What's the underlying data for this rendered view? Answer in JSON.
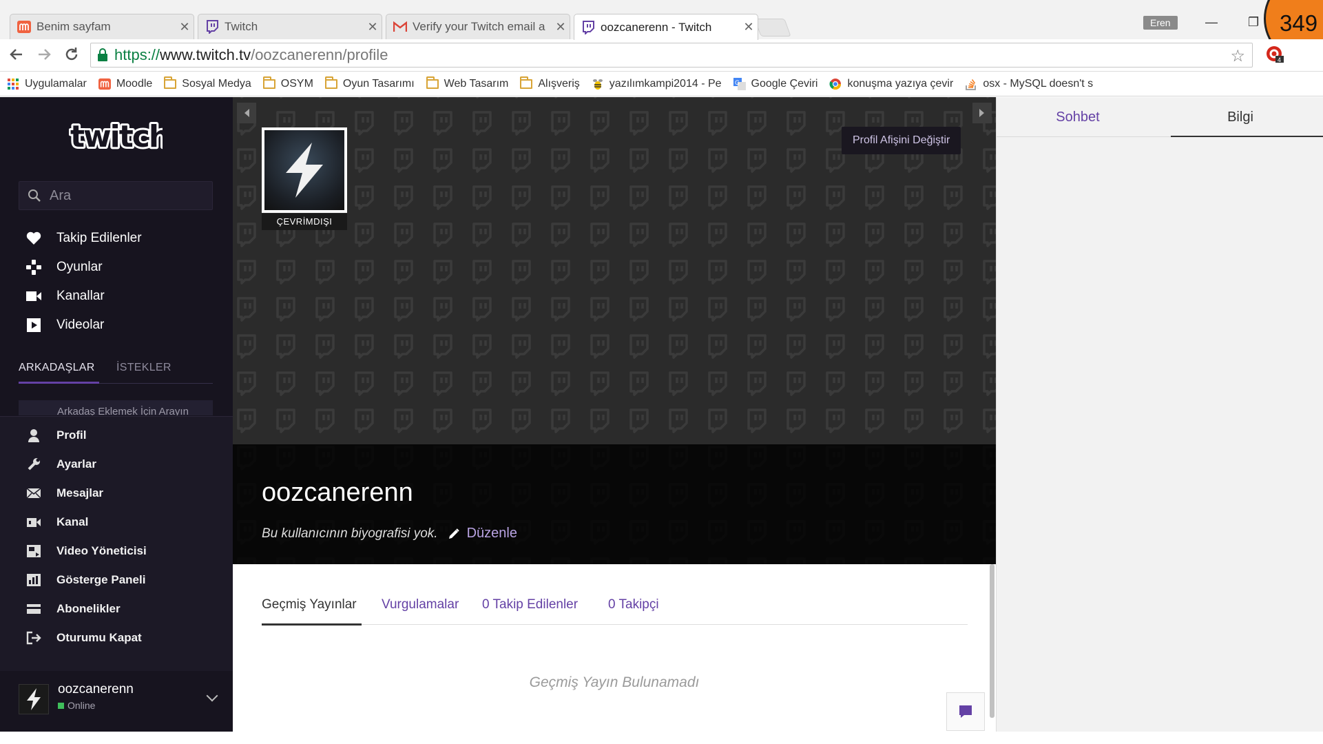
{
  "browser": {
    "tabs": [
      {
        "title": "Benim sayfam",
        "icon": "moodle-icon"
      },
      {
        "title": "Twitch",
        "icon": "twitch-icon"
      },
      {
        "title": "Verify your Twitch email a",
        "icon": "gmail-icon"
      },
      {
        "title": "oozcanerenn - Twitch",
        "icon": "twitch-icon",
        "active": true
      }
    ],
    "user_badge": "Eren",
    "counter_badge": "349",
    "url": {
      "scheme": "https://",
      "host": "www.twitch.tv",
      "path": "/oozcanerenn/profile"
    },
    "bookmarks": [
      {
        "label": "Uygulamalar",
        "icon": "apps-grid-icon"
      },
      {
        "label": "Moodle",
        "icon": "moodle-icon"
      },
      {
        "label": "Sosyal Medya",
        "icon": "folder-icon"
      },
      {
        "label": "OSYM",
        "icon": "folder-icon"
      },
      {
        "label": "Oyun Tasarımı",
        "icon": "folder-icon"
      },
      {
        "label": "Web Tasarım",
        "icon": "folder-icon"
      },
      {
        "label": "Alışveriş",
        "icon": "folder-icon"
      },
      {
        "label": "yazılımkampi2014 - Pe",
        "icon": "bee-icon"
      },
      {
        "label": "Google Çeviri",
        "icon": "translate-icon"
      },
      {
        "label": "konuşma yazıya çevir",
        "icon": "chrome-icon"
      },
      {
        "label": "osx - MySQL doesn't s",
        "icon": "stackoverflow-icon"
      }
    ]
  },
  "sidebar": {
    "search_placeholder": "Ara",
    "nav": [
      {
        "label": "Takip Edilenler",
        "icon": "heart-icon"
      },
      {
        "label": "Oyunlar",
        "icon": "gamepad-icon"
      },
      {
        "label": "Kanallar",
        "icon": "camera-icon"
      },
      {
        "label": "Videolar",
        "icon": "play-icon"
      }
    ],
    "friends_tabs": {
      "friends": "ARKADAŞLAR",
      "requests": "İSTEKLER"
    },
    "friend_search_placeholder": "Arkadaş Eklemek İçin Arayın",
    "menu": [
      {
        "label": "Profil",
        "icon": "user-icon"
      },
      {
        "label": "Ayarlar",
        "icon": "wrench-icon"
      },
      {
        "label": "Mesajlar",
        "icon": "envelope-icon"
      },
      {
        "label": "Kanal",
        "icon": "channel-icon"
      },
      {
        "label": "Video Yöneticisi",
        "icon": "video-manager-icon"
      },
      {
        "label": "Gösterge Paneli",
        "icon": "dashboard-icon"
      },
      {
        "label": "Abonelikler",
        "icon": "card-icon"
      },
      {
        "label": "Oturumu Kapat",
        "icon": "logout-icon"
      }
    ],
    "user": {
      "name": "oozcanerenn",
      "status": "Online"
    }
  },
  "profile": {
    "offline_label": "ÇEVRİMDIŞI",
    "change_banner_label": "Profil Afişini Değiştir",
    "username": "oozcanerenn",
    "bio": "Bu kullanıcının biyografisi yok.",
    "edit_label": "Düzenle",
    "tabs": [
      {
        "label": "Geçmiş Yayınlar",
        "active": true
      },
      {
        "label": "Vurgulamalar"
      },
      {
        "label": "0 Takip Edilenler"
      },
      {
        "label": "0 Takipçi"
      }
    ],
    "empty_message": "Geçmiş Yayın Bulunamadı"
  },
  "right_panel": {
    "tabs": {
      "chat": "Sohbet",
      "info": "Bilgi"
    }
  },
  "colors": {
    "twitch_purple": "#6441a5",
    "sidebar_bg": "#17141f",
    "online_green": "#3fbe5b"
  }
}
